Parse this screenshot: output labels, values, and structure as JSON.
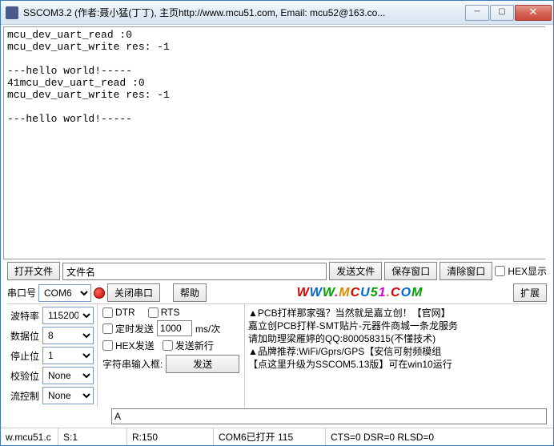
{
  "window": {
    "title": "SSCOM3.2 (作者:聂小猛(丁丁), 主页http://www.mcu51.com, Email: mcu52@163.co..."
  },
  "console_text": "mcu_dev_uart_read :0\nmcu_dev_uart_write res: -1\n\n---hello world!-----\n41mcu_dev_uart_read :0\nmcu_dev_uart_write res: -1\n\n---hello world!-----",
  "toolbar1": {
    "open_file": "打开文件",
    "filename": "文件名",
    "send_file": "发送文件",
    "save_window": "保存窗口",
    "clear_window": "清除窗口",
    "hex_show": "HEX显示"
  },
  "toolbar2": {
    "port_label": "串口号",
    "port_value": "COM6",
    "close_port": "关闭串口",
    "help": "帮助",
    "url": "WWW.MCU51.COM",
    "expand": "扩展"
  },
  "params": {
    "baud_label": "波特率",
    "baud_value": "115200",
    "data_label": "数据位",
    "data_value": "8",
    "stop_label": "停止位",
    "stop_value": "1",
    "parity_label": "校验位",
    "parity_value": "None",
    "flow_label": "流控制",
    "flow_value": "None"
  },
  "mid": {
    "dtr": "DTR",
    "rts": "RTS",
    "timed": "定时发送",
    "interval_value": "1000",
    "interval_unit": "ms/次",
    "hex_send": "HEX发送",
    "send_newline": "发送新行",
    "input_label": "字符串输入框:",
    "send_btn": "发送",
    "input_value": "A"
  },
  "info": {
    "l1": "▲PCB打样那家强？当然就是嘉立创！【官网】",
    "l2": "嘉立创PCB打样-SMT贴片-元器件商城一条龙服务",
    "l3": "请加助理梁雁婷的QQ:800058315(不懂技术)",
    "l4": "▲品牌推荐:WiFi/Gprs/GPS【安信可射频模组",
    "l5": "【点这里升级为SSCOM5.13版】可在win10运行"
  },
  "status": {
    "c1": "w.mcu51.c",
    "c2": "S:1",
    "c3": "R:150",
    "c4": "COM6已打开   115",
    "c5": "CTS=0 DSR=0 RLSD=0"
  }
}
